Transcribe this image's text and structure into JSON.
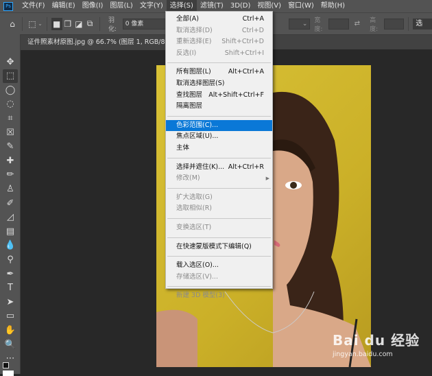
{
  "app": {
    "logo": "Ps"
  },
  "menubar": [
    "文件(F)",
    "编辑(E)",
    "图像(I)",
    "图层(L)",
    "文字(Y)",
    "选择(S)",
    "滤镜(T)",
    "3D(D)",
    "视图(V)",
    "窗口(W)",
    "帮助(H)"
  ],
  "options": {
    "feather_label": "羽化:",
    "feather_value": "0 像素",
    "width_label": "宽度:",
    "height_label": "高度:",
    "select_mask_button": "选"
  },
  "document_tab": "证件照素材原图.jpg @ 66.7% (图层 1, RGB/8) *",
  "select_menu": {
    "groups": [
      [
        {
          "label": "全部(A)",
          "shortcut": "Ctrl+A",
          "enabled": true
        },
        {
          "label": "取消选择(D)",
          "shortcut": "Ctrl+D",
          "enabled": false
        },
        {
          "label": "重新选择(E)",
          "shortcut": "Shift+Ctrl+D",
          "enabled": false
        },
        {
          "label": "反选(I)",
          "shortcut": "Shift+Ctrl+I",
          "enabled": false
        }
      ],
      [
        {
          "label": "所有图层(L)",
          "shortcut": "Alt+Ctrl+A",
          "enabled": true
        },
        {
          "label": "取消选择图层(S)",
          "shortcut": "",
          "enabled": true
        },
        {
          "label": "查找图层",
          "shortcut": "Alt+Shift+Ctrl+F",
          "enabled": true
        },
        {
          "label": "隔离图层",
          "shortcut": "",
          "enabled": true
        }
      ],
      [
        {
          "label": "色彩范围(C)...",
          "shortcut": "",
          "enabled": true,
          "highlighted": true
        },
        {
          "label": "焦点区域(U)...",
          "shortcut": "",
          "enabled": true
        },
        {
          "label": "主体",
          "shortcut": "",
          "enabled": true
        }
      ],
      [
        {
          "label": "选择并遮住(K)...",
          "shortcut": "Alt+Ctrl+R",
          "enabled": true
        },
        {
          "label": "修改(M)",
          "shortcut": "",
          "enabled": false,
          "submenu": true
        }
      ],
      [
        {
          "label": "扩大选取(G)",
          "shortcut": "",
          "enabled": false
        },
        {
          "label": "选取相似(R)",
          "shortcut": "",
          "enabled": false
        }
      ],
      [
        {
          "label": "变换选区(T)",
          "shortcut": "",
          "enabled": false
        }
      ],
      [
        {
          "label": "在快速蒙版模式下编辑(Q)",
          "shortcut": "",
          "enabled": true
        }
      ],
      [
        {
          "label": "载入选区(O)...",
          "shortcut": "",
          "enabled": true
        },
        {
          "label": "存储选区(V)...",
          "shortcut": "",
          "enabled": false
        }
      ],
      [
        {
          "label": "新建 3D 模型(3)",
          "shortcut": "",
          "enabled": false
        }
      ]
    ]
  },
  "tools": [
    "move-icon",
    "marquee-icon",
    "lasso-icon",
    "quick-select-icon",
    "crop-icon",
    "frame-icon",
    "eyedropper-icon",
    "healing-icon",
    "brush-icon",
    "stamp-icon",
    "history-brush-icon",
    "eraser-icon",
    "gradient-icon",
    "blur-icon",
    "dodge-icon",
    "pen-icon",
    "type-icon",
    "path-select-icon",
    "rectangle-icon",
    "hand-icon",
    "zoom-icon",
    "more-icon"
  ],
  "watermark": {
    "brand": "Bai du 经验",
    "url": "jingyan.baidu.com"
  },
  "colors": {
    "highlight": "#0a78d7",
    "canvas_bg": "#d4b92a"
  }
}
